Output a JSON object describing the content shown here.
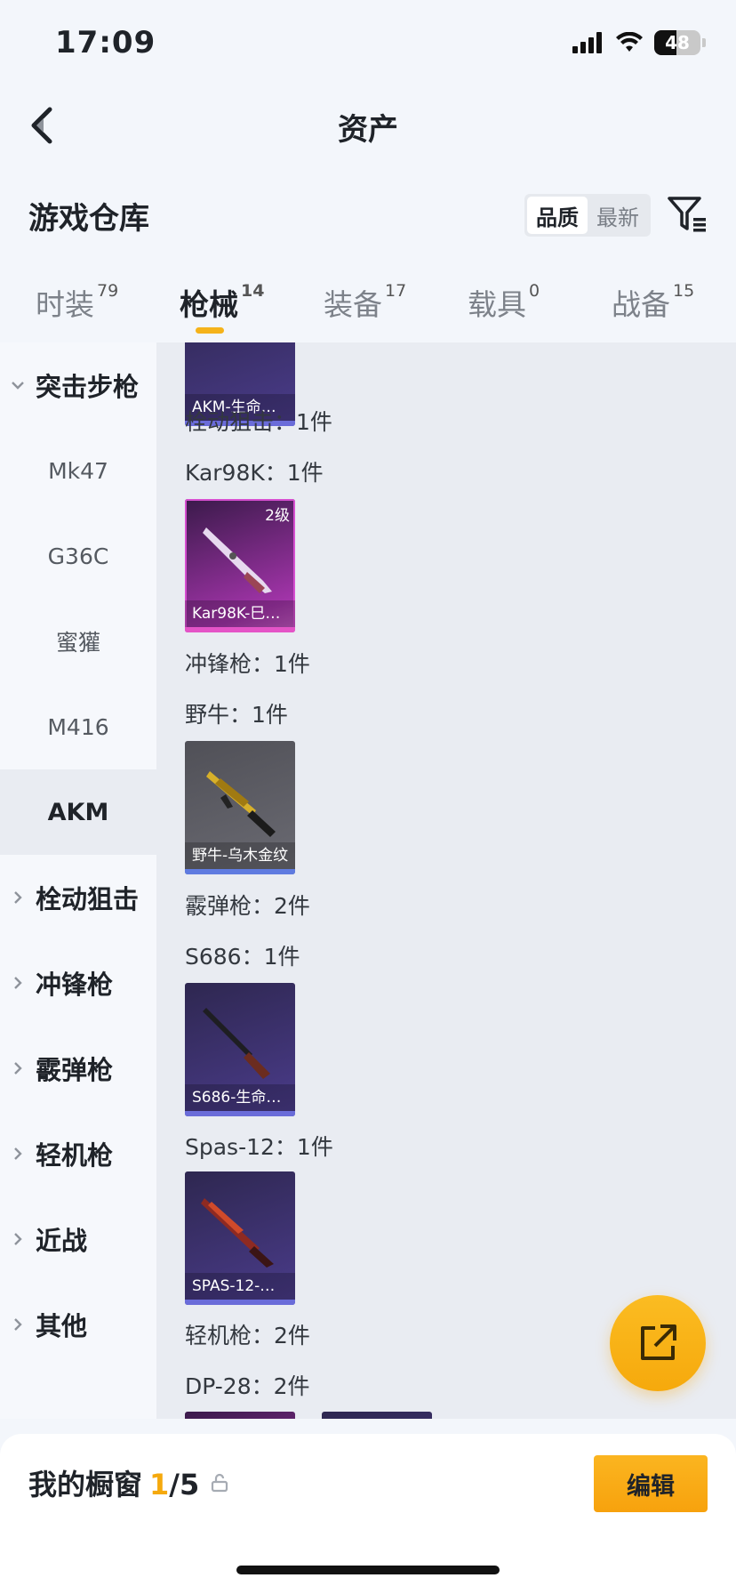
{
  "status_bar": {
    "time": "17:09",
    "battery": "48"
  },
  "nav": {
    "title": "资产"
  },
  "warehouse": {
    "title": "游戏仓库",
    "sort_options": [
      {
        "label": "品质",
        "active": true
      },
      {
        "label": "最新",
        "active": false
      }
    ]
  },
  "tabs": [
    {
      "label": "时装",
      "count": "79",
      "active": false
    },
    {
      "label": "枪械",
      "count": "14",
      "active": true
    },
    {
      "label": "装备",
      "count": "17",
      "active": false
    },
    {
      "label": "载具",
      "count": "0",
      "active": false
    },
    {
      "label": "战备",
      "count": "15",
      "active": false
    }
  ],
  "sidebar": {
    "category_open": "突击步枪",
    "sub_items": [
      "Mk47",
      "G36C",
      "蜜獾",
      "M416",
      "AKM"
    ],
    "active_sub": "AKM",
    "categories": [
      "栓动狙击",
      "冲锋枪",
      "霰弹枪",
      "轻机枪",
      "近战",
      "其他"
    ]
  },
  "content": {
    "top_card_name": "AKM-生命…",
    "labels": [
      "栓动狙击：1件",
      "Kar98K：1件",
      "冲锋枪：1件",
      "野牛：1件",
      "霰弹枪：2件",
      "S686：1件",
      "Spas-12：1件",
      "轻机枪：2件",
      "DP-28：2件"
    ],
    "cards": [
      {
        "name": "Kar98K-巳…",
        "level": "2级",
        "rarity": "pink"
      },
      {
        "name": "野牛-乌木金纹",
        "level": "",
        "rarity": "grey"
      },
      {
        "name": "S686-生命…",
        "level": "",
        "rarity": "purple"
      },
      {
        "name": "SPAS-12-…",
        "level": "",
        "rarity": "purple"
      }
    ]
  },
  "showcase": {
    "label": "我的橱窗",
    "current": "1",
    "total": "/5",
    "edit_label": "编辑"
  },
  "icons": {
    "back": "chevron-left-icon",
    "filter": "filter-icon",
    "share": "share-external-icon",
    "lock": "lock-icon"
  },
  "colors": {
    "accent": "#f5b31a"
  }
}
